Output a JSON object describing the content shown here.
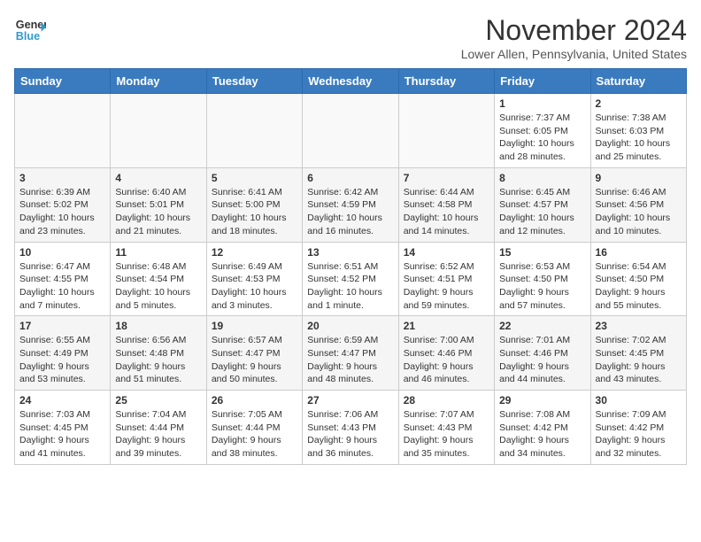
{
  "header": {
    "logo_line1": "General",
    "logo_line2": "Blue",
    "month": "November 2024",
    "location": "Lower Allen, Pennsylvania, United States"
  },
  "days_of_week": [
    "Sunday",
    "Monday",
    "Tuesday",
    "Wednesday",
    "Thursday",
    "Friday",
    "Saturday"
  ],
  "weeks": [
    [
      {
        "day": "",
        "info": ""
      },
      {
        "day": "",
        "info": ""
      },
      {
        "day": "",
        "info": ""
      },
      {
        "day": "",
        "info": ""
      },
      {
        "day": "",
        "info": ""
      },
      {
        "day": "1",
        "info": "Sunrise: 7:37 AM\nSunset: 6:05 PM\nDaylight: 10 hours and 28 minutes."
      },
      {
        "day": "2",
        "info": "Sunrise: 7:38 AM\nSunset: 6:03 PM\nDaylight: 10 hours and 25 minutes."
      }
    ],
    [
      {
        "day": "3",
        "info": "Sunrise: 6:39 AM\nSunset: 5:02 PM\nDaylight: 10 hours and 23 minutes."
      },
      {
        "day": "4",
        "info": "Sunrise: 6:40 AM\nSunset: 5:01 PM\nDaylight: 10 hours and 21 minutes."
      },
      {
        "day": "5",
        "info": "Sunrise: 6:41 AM\nSunset: 5:00 PM\nDaylight: 10 hours and 18 minutes."
      },
      {
        "day": "6",
        "info": "Sunrise: 6:42 AM\nSunset: 4:59 PM\nDaylight: 10 hours and 16 minutes."
      },
      {
        "day": "7",
        "info": "Sunrise: 6:44 AM\nSunset: 4:58 PM\nDaylight: 10 hours and 14 minutes."
      },
      {
        "day": "8",
        "info": "Sunrise: 6:45 AM\nSunset: 4:57 PM\nDaylight: 10 hours and 12 minutes."
      },
      {
        "day": "9",
        "info": "Sunrise: 6:46 AM\nSunset: 4:56 PM\nDaylight: 10 hours and 10 minutes."
      }
    ],
    [
      {
        "day": "10",
        "info": "Sunrise: 6:47 AM\nSunset: 4:55 PM\nDaylight: 10 hours and 7 minutes."
      },
      {
        "day": "11",
        "info": "Sunrise: 6:48 AM\nSunset: 4:54 PM\nDaylight: 10 hours and 5 minutes."
      },
      {
        "day": "12",
        "info": "Sunrise: 6:49 AM\nSunset: 4:53 PM\nDaylight: 10 hours and 3 minutes."
      },
      {
        "day": "13",
        "info": "Sunrise: 6:51 AM\nSunset: 4:52 PM\nDaylight: 10 hours and 1 minute."
      },
      {
        "day": "14",
        "info": "Sunrise: 6:52 AM\nSunset: 4:51 PM\nDaylight: 9 hours and 59 minutes."
      },
      {
        "day": "15",
        "info": "Sunrise: 6:53 AM\nSunset: 4:50 PM\nDaylight: 9 hours and 57 minutes."
      },
      {
        "day": "16",
        "info": "Sunrise: 6:54 AM\nSunset: 4:50 PM\nDaylight: 9 hours and 55 minutes."
      }
    ],
    [
      {
        "day": "17",
        "info": "Sunrise: 6:55 AM\nSunset: 4:49 PM\nDaylight: 9 hours and 53 minutes."
      },
      {
        "day": "18",
        "info": "Sunrise: 6:56 AM\nSunset: 4:48 PM\nDaylight: 9 hours and 51 minutes."
      },
      {
        "day": "19",
        "info": "Sunrise: 6:57 AM\nSunset: 4:47 PM\nDaylight: 9 hours and 50 minutes."
      },
      {
        "day": "20",
        "info": "Sunrise: 6:59 AM\nSunset: 4:47 PM\nDaylight: 9 hours and 48 minutes."
      },
      {
        "day": "21",
        "info": "Sunrise: 7:00 AM\nSunset: 4:46 PM\nDaylight: 9 hours and 46 minutes."
      },
      {
        "day": "22",
        "info": "Sunrise: 7:01 AM\nSunset: 4:46 PM\nDaylight: 9 hours and 44 minutes."
      },
      {
        "day": "23",
        "info": "Sunrise: 7:02 AM\nSunset: 4:45 PM\nDaylight: 9 hours and 43 minutes."
      }
    ],
    [
      {
        "day": "24",
        "info": "Sunrise: 7:03 AM\nSunset: 4:45 PM\nDaylight: 9 hours and 41 minutes."
      },
      {
        "day": "25",
        "info": "Sunrise: 7:04 AM\nSunset: 4:44 PM\nDaylight: 9 hours and 39 minutes."
      },
      {
        "day": "26",
        "info": "Sunrise: 7:05 AM\nSunset: 4:44 PM\nDaylight: 9 hours and 38 minutes."
      },
      {
        "day": "27",
        "info": "Sunrise: 7:06 AM\nSunset: 4:43 PM\nDaylight: 9 hours and 36 minutes."
      },
      {
        "day": "28",
        "info": "Sunrise: 7:07 AM\nSunset: 4:43 PM\nDaylight: 9 hours and 35 minutes."
      },
      {
        "day": "29",
        "info": "Sunrise: 7:08 AM\nSunset: 4:42 PM\nDaylight: 9 hours and 34 minutes."
      },
      {
        "day": "30",
        "info": "Sunrise: 7:09 AM\nSunset: 4:42 PM\nDaylight: 9 hours and 32 minutes."
      }
    ]
  ]
}
